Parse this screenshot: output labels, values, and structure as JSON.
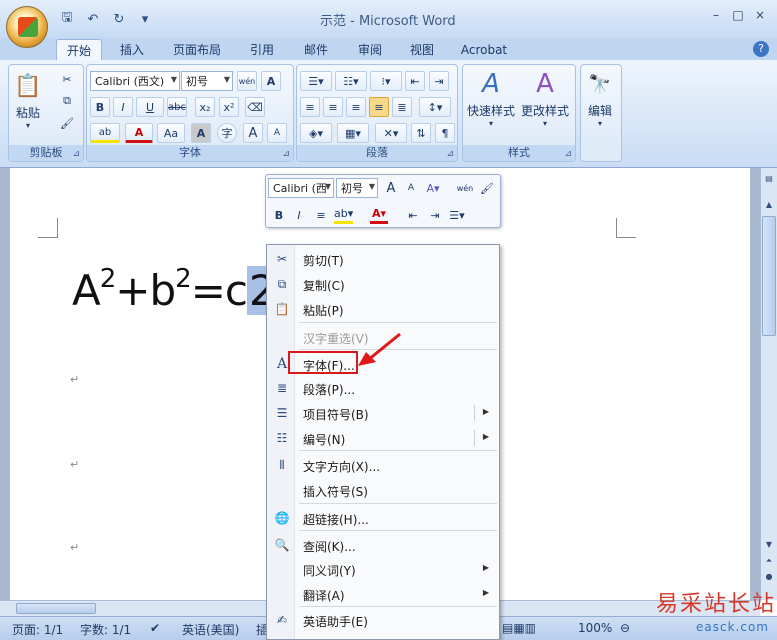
{
  "window": {
    "title": "示范 - Microsoft Word",
    "controls": [
      "–",
      "□",
      "×"
    ]
  },
  "qat": {
    "save_icon": "save-icon",
    "undo_icon": "undo-icon",
    "redo_icon": "redo-icon",
    "customize": "▾"
  },
  "tabs": [
    "开始",
    "插入",
    "页面布局",
    "引用",
    "邮件",
    "审阅",
    "视图",
    "Acrobat"
  ],
  "ribbon": {
    "clipboard": {
      "label": "剪贴板",
      "paste": "粘贴"
    },
    "font": {
      "label": "字体",
      "font_name": "Calibri (西文)",
      "font_size": "初号",
      "phonetic": "wén",
      "border_char": "A",
      "bold": "B",
      "italic": "I",
      "underline": "U",
      "strike": "abc",
      "subscript": "x₂",
      "superscript": "x²",
      "highlight": "ab",
      "font_color": "A",
      "change_case": "Aa",
      "shade_char": "A",
      "enclose": "字",
      "grow": "A",
      "shrink": "A"
    },
    "paragraph": {
      "label": "段落"
    },
    "styles": {
      "label": "样式",
      "quick_styles": "快速样式",
      "change_styles": "更改样式"
    },
    "editing": {
      "label": "编辑"
    }
  },
  "document": {
    "formula_a": "A",
    "formula_sup1": "2",
    "formula_plus_b": "+b",
    "formula_sup2": "2",
    "formula_eq_c": "=c",
    "formula_selected": "2",
    "para_mark": "↵"
  },
  "mini_toolbar": {
    "font_name": "Calibri (西",
    "font_size": "初号",
    "grow": "A",
    "shrink": "A",
    "phonetic": "wén",
    "bold": "B",
    "italic": "I"
  },
  "context_menu": {
    "items": [
      {
        "label": "剪切(T)",
        "icon": "scissors-icon",
        "glyph": "✂",
        "disabled": false,
        "submenu": false
      },
      {
        "label": "复制(C)",
        "icon": "copy-icon",
        "glyph": "⧉",
        "disabled": false,
        "submenu": false
      },
      {
        "label": "粘贴(P)",
        "icon": "paste-icon",
        "glyph": "📋",
        "disabled": false,
        "submenu": false
      },
      {
        "label": "汉字重选(V)",
        "icon": "",
        "glyph": "",
        "disabled": true,
        "submenu": false
      },
      {
        "label": "字体(F)...",
        "icon": "font-icon",
        "glyph": "A",
        "disabled": false,
        "submenu": false
      },
      {
        "label": "段落(P)...",
        "icon": "paragraph-icon",
        "glyph": "≣",
        "disabled": false,
        "submenu": false
      },
      {
        "label": "项目符号(B)",
        "icon": "bullets-icon",
        "glyph": "☰",
        "disabled": false,
        "submenu": true
      },
      {
        "label": "编号(N)",
        "icon": "numbering-icon",
        "glyph": "☷",
        "disabled": false,
        "submenu": true
      },
      {
        "label": "文字方向(X)...",
        "icon": "text-direction-icon",
        "glyph": "⦀",
        "disabled": false,
        "submenu": false
      },
      {
        "label": "插入符号(S)",
        "icon": "",
        "glyph": "",
        "disabled": false,
        "submenu": false
      },
      {
        "label": "超链接(H)...",
        "icon": "hyperlink-icon",
        "glyph": "🌐",
        "disabled": false,
        "submenu": false
      },
      {
        "label": "查阅(K)...",
        "icon": "lookup-icon",
        "glyph": "🔍",
        "disabled": false,
        "submenu": false
      },
      {
        "label": "同义词(Y)",
        "icon": "",
        "glyph": "",
        "disabled": false,
        "submenu": true
      },
      {
        "label": "翻译(A)",
        "icon": "",
        "glyph": "",
        "disabled": false,
        "submenu": true
      },
      {
        "label": "英语助手(E)",
        "icon": "english-assistant-icon",
        "glyph": "✍",
        "disabled": false,
        "submenu": false
      }
    ]
  },
  "status": {
    "page": "页面: 1/1",
    "words": "字数: 1/1",
    "language": "英语(美国)",
    "insert_trunc": "插",
    "zoom": "100%"
  },
  "watermark": {
    "cn": "易采站长站",
    "en": "easck.com"
  },
  "colors": {
    "highlight_box": "#d8181c",
    "selection": "#a8c0e6"
  }
}
